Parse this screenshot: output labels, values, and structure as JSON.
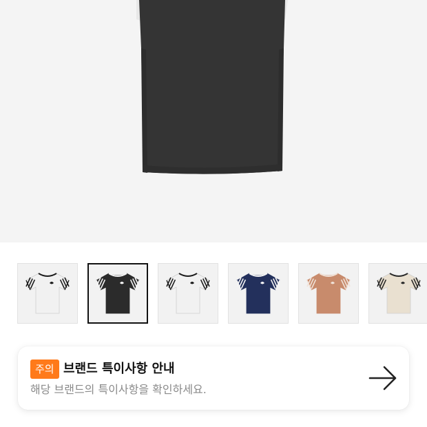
{
  "product": {
    "main_image_icon": "black-tshirt-image"
  },
  "thumbnails": [
    {
      "icon": "white-tshirt-black-stripes",
      "body_color": "#f1f1f1",
      "stripe_color": "#1c1c1c",
      "trim_color": "#1c1c1c",
      "selected": false
    },
    {
      "icon": "black-tshirt-white-stripes",
      "body_color": "#2b2b2b",
      "stripe_color": "#f5f5f5",
      "trim_color": "#f5f5f5",
      "selected": true
    },
    {
      "icon": "white-tshirt-black-stripes",
      "body_color": "#f1f1f1",
      "stripe_color": "#1c1c1c",
      "trim_color": "#1c1c1c",
      "selected": false
    },
    {
      "icon": "navy-tshirt-white-stripes",
      "body_color": "#23305c",
      "stripe_color": "#f5f5f5",
      "trim_color": "#f5f5f5",
      "selected": false
    },
    {
      "icon": "brown-tshirt-white-stripes",
      "body_color": "#c88b6c",
      "stripe_color": "#f0e2d8",
      "trim_color": "#f0e2d8",
      "selected": false
    },
    {
      "icon": "beige-tshirt-dark-stripes",
      "body_color": "#e9e0d0",
      "stripe_color": "#2a2a2a",
      "trim_color": "#2a2a2a",
      "selected": false
    }
  ],
  "notice": {
    "badge": "주의",
    "title": "브랜드 특이사항 안내",
    "description": "해당 브랜드의 특이사항을 확인하세요.",
    "arrow_icon": "arrow-right-icon"
  },
  "colors": {
    "badge": "#ff7a1a",
    "hero_background": "#f4f4f4"
  }
}
